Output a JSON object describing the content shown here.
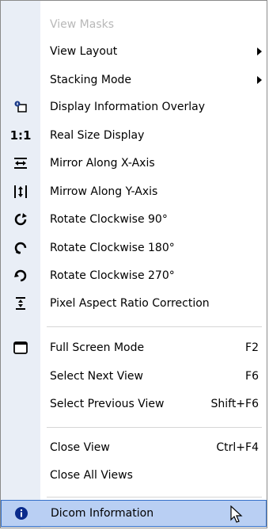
{
  "menu": {
    "items": [
      {
        "label": "View Masks",
        "disabled": true
      },
      {
        "label": "View Layout",
        "submenu": true
      },
      {
        "label": "Stacking Mode",
        "submenu": true
      },
      {
        "label": "Display Information Overlay",
        "icon": "info-overlay-icon"
      },
      {
        "label": "Real Size Display",
        "icon": "real-size-icon",
        "icon_text": "1:1"
      },
      {
        "label": "Mirror Along X-Axis",
        "icon": "mirror-x-icon"
      },
      {
        "label": "Mirrow Along Y-Axis",
        "icon": "mirror-y-icon"
      },
      {
        "label": "Rotate Clockwise 90°",
        "icon": "rotate-90-icon"
      },
      {
        "label": "Rotate Clockwise 180°",
        "icon": "rotate-180-icon"
      },
      {
        "label": "Rotate Clockwise 270°",
        "icon": "rotate-270-icon"
      },
      {
        "label": "Pixel Aspect Ratio Correction",
        "icon": "aspect-ratio-icon"
      },
      {
        "label": "Full Screen Mode",
        "icon": "full-screen-icon",
        "shortcut": "F2"
      },
      {
        "label": "Select Next View",
        "shortcut": "F6"
      },
      {
        "label": "Select Previous View",
        "shortcut": "Shift+F6"
      },
      {
        "label": "Close View",
        "shortcut": "Ctrl+F4"
      },
      {
        "label": "Close All Views"
      },
      {
        "label": "Dicom Information",
        "icon": "info-icon",
        "highlighted": true
      }
    ]
  },
  "colors": {
    "gutter": "#e9eef6",
    "highlight": "#b9cff3",
    "highlight_border": "#3470c9",
    "disabled_text": "#b8b8b8"
  }
}
